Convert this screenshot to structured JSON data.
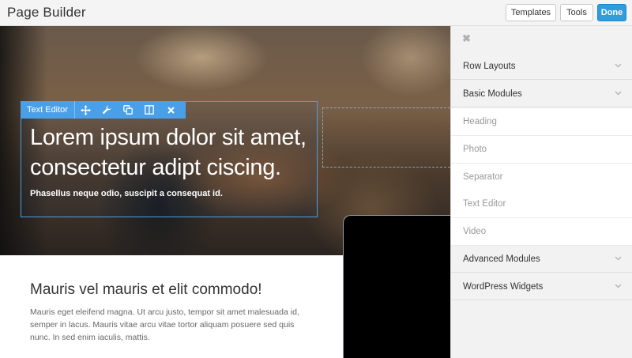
{
  "app": {
    "title": "Page Builder"
  },
  "toolbar": {
    "templates_label": "Templates",
    "tools_label": "Tools",
    "done_label": "Done"
  },
  "hero": {
    "editor_label": "Text Editor",
    "toolbar_icons": [
      "move-icon",
      "wrench-icon",
      "duplicate-icon",
      "columns-icon",
      "close-icon"
    ],
    "title": "Lorem ipsum dolor sit amet, consectetur adipt ciscing.",
    "subtitle": "Phasellus neque odio, suscipit a consequat id."
  },
  "content": {
    "title": "Mauris vel mauris et elit commodo!",
    "body": "Mauris eget eleifend magna. Ut arcu justo, tempor sit amet malesuada id, semper in lacus. Mauris vitae arcu vitae tortor aliquam posuere sed quis nunc. In sed enim iaculis, mattis."
  },
  "panel": {
    "close_icon": "close-icon",
    "sections": [
      {
        "label": "Row Layouts"
      },
      {
        "label": "Basic Modules"
      },
      {
        "label": "Advanced Modules"
      },
      {
        "label": "WordPress Widgets"
      }
    ],
    "basic_modules": [
      "Heading",
      "Photo",
      "Separator",
      "Text Editor",
      "Video"
    ]
  },
  "colors": {
    "accent": "#4aa0e8",
    "done": "#2f9ddc"
  }
}
